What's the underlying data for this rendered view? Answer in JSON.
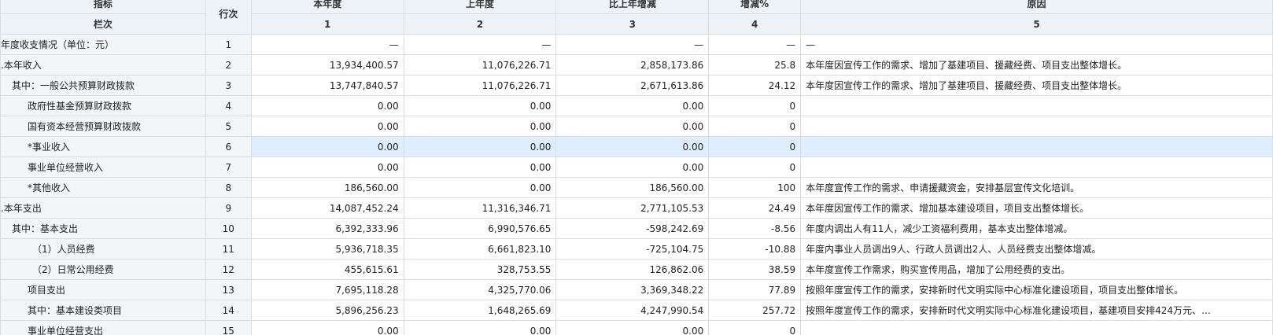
{
  "header": {
    "indicator": "指标",
    "row_no": "行次",
    "current_year": "本年度",
    "prev_year": "上年度",
    "change": "比上年增减",
    "change_pct": "增减%",
    "reason": "原因",
    "sub_label": "栏次",
    "col1": "1",
    "col2": "2",
    "col3": "3",
    "col4": "4",
    "col5": "5"
  },
  "rows": [
    {
      "name": "年度收支情况（单位：元）",
      "no": "1",
      "cur": "—",
      "prev": "—",
      "chg": "—",
      "pct": "—",
      "reason": "—"
    },
    {
      "name": ".本年收入",
      "no": "2",
      "cur": "13,934,400.57",
      "prev": "11,076,226.71",
      "chg": "2,858,173.86",
      "pct": "25.8",
      "reason": "本年度因宣传工作的需求、增加了基建项目、援藏经费、项目支出整体增长。"
    },
    {
      "name": "其中：一般公共预算财政拨款",
      "no": "3",
      "cur": "13,747,840.57",
      "prev": "11,076,226.71",
      "chg": "2,671,613.86",
      "pct": "24.12",
      "reason": "本年度因宣传工作的需求、增加了基建项目、援藏经费、项目支出整体增长。"
    },
    {
      "name": "政府性基金预算财政拨款",
      "no": "4",
      "cur": "0.00",
      "prev": "0.00",
      "chg": "0.00",
      "pct": "0",
      "reason": ""
    },
    {
      "name": "国有资本经营预算财政拨款",
      "no": "5",
      "cur": "0.00",
      "prev": "0.00",
      "chg": "0.00",
      "pct": "0",
      "reason": ""
    },
    {
      "name": "*事业收入",
      "no": "6",
      "cur": "0.00",
      "prev": "0.00",
      "chg": "0.00",
      "pct": "0",
      "reason": ""
    },
    {
      "name": "事业单位经营收入",
      "no": "7",
      "cur": "0.00",
      "prev": "0.00",
      "chg": "0.00",
      "pct": "0",
      "reason": ""
    },
    {
      "name": "*其他收入",
      "no": "8",
      "cur": "186,560.00",
      "prev": "0.00",
      "chg": "186,560.00",
      "pct": "100",
      "reason": "本年度宣传工作的需求、申请援藏资金，安排基层宣传文化培训。"
    },
    {
      "name": ".本年支出",
      "no": "9",
      "cur": "14,087,452.24",
      "prev": "11,316,346.71",
      "chg": "2,771,105.53",
      "pct": "24.49",
      "reason": "本年度因宣传工作的需求、增加基本建设项目，项目支出整体增长。"
    },
    {
      "name": "其中：基本支出",
      "no": "10",
      "cur": "6,392,333.96",
      "prev": "6,990,576.65",
      "chg": "-598,242.69",
      "pct": "-8.56",
      "reason": "年度内调出人有11人，减少工资福利费用，基本支出整体增减。"
    },
    {
      "name": "（1）人员经费",
      "no": "11",
      "cur": "5,936,718.35",
      "prev": "6,661,823.10",
      "chg": "-725,104.75",
      "pct": "-10.88",
      "reason": "年度内事业人员调出9人、行政人员调出2人、人员经费支出整体增减。"
    },
    {
      "name": "（2）日常公用经费",
      "no": "12",
      "cur": "455,615.61",
      "prev": "328,753.55",
      "chg": "126,862.06",
      "pct": "38.59",
      "reason": "本年度宣传工作需求，购买宣传用品，增加了公用经费的支出。"
    },
    {
      "name": "项目支出",
      "no": "13",
      "cur": "7,695,118.28",
      "prev": "4,325,770.06",
      "chg": "3,369,348.22",
      "pct": "77.89",
      "reason": "按照年度宣传工作的需求，安排新时代文明实际中心标准化建设项目，项目支出整体增长。"
    },
    {
      "name": "其中：基本建设类项目",
      "no": "14",
      "cur": "5,896,256.23",
      "prev": "1,648,265.69",
      "chg": "4,247,990.54",
      "pct": "257.72",
      "reason": "按照年度宣传工作的需求，安排新时代文明实际中心标准化建设项目，基建项目安排424万元、…"
    },
    {
      "name": "事业单位经营支出",
      "no": "15",
      "cur": "0.00",
      "prev": "0.00",
      "chg": "0.00",
      "pct": "0",
      "reason": ""
    }
  ]
}
